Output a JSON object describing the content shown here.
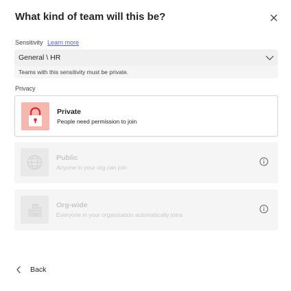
{
  "dialog": {
    "title": "What kind of team will this be?"
  },
  "sensitivity": {
    "label": "Sensitivity",
    "learn_more": "Learn more",
    "selected_value": "General \\ HR",
    "note": "Teams with this sensitivity must be private."
  },
  "privacy": {
    "label": "Privacy",
    "options": [
      {
        "title": "Private",
        "description": "People need permission to join",
        "icon": "lock-icon",
        "state": "selected"
      },
      {
        "title": "Public",
        "description": "Anyone in your org can join",
        "icon": "globe-icon",
        "state": "disabled"
      },
      {
        "title": "Org-wide",
        "description": "Everyone in your organisation automatically joins",
        "icon": "building-icon",
        "state": "disabled"
      }
    ]
  },
  "footer": {
    "back_label": "Back"
  },
  "colors": {
    "accent": "#5b5fc7",
    "lock_tile": "#f4b8b0",
    "lock_glyph": "#d13438"
  }
}
